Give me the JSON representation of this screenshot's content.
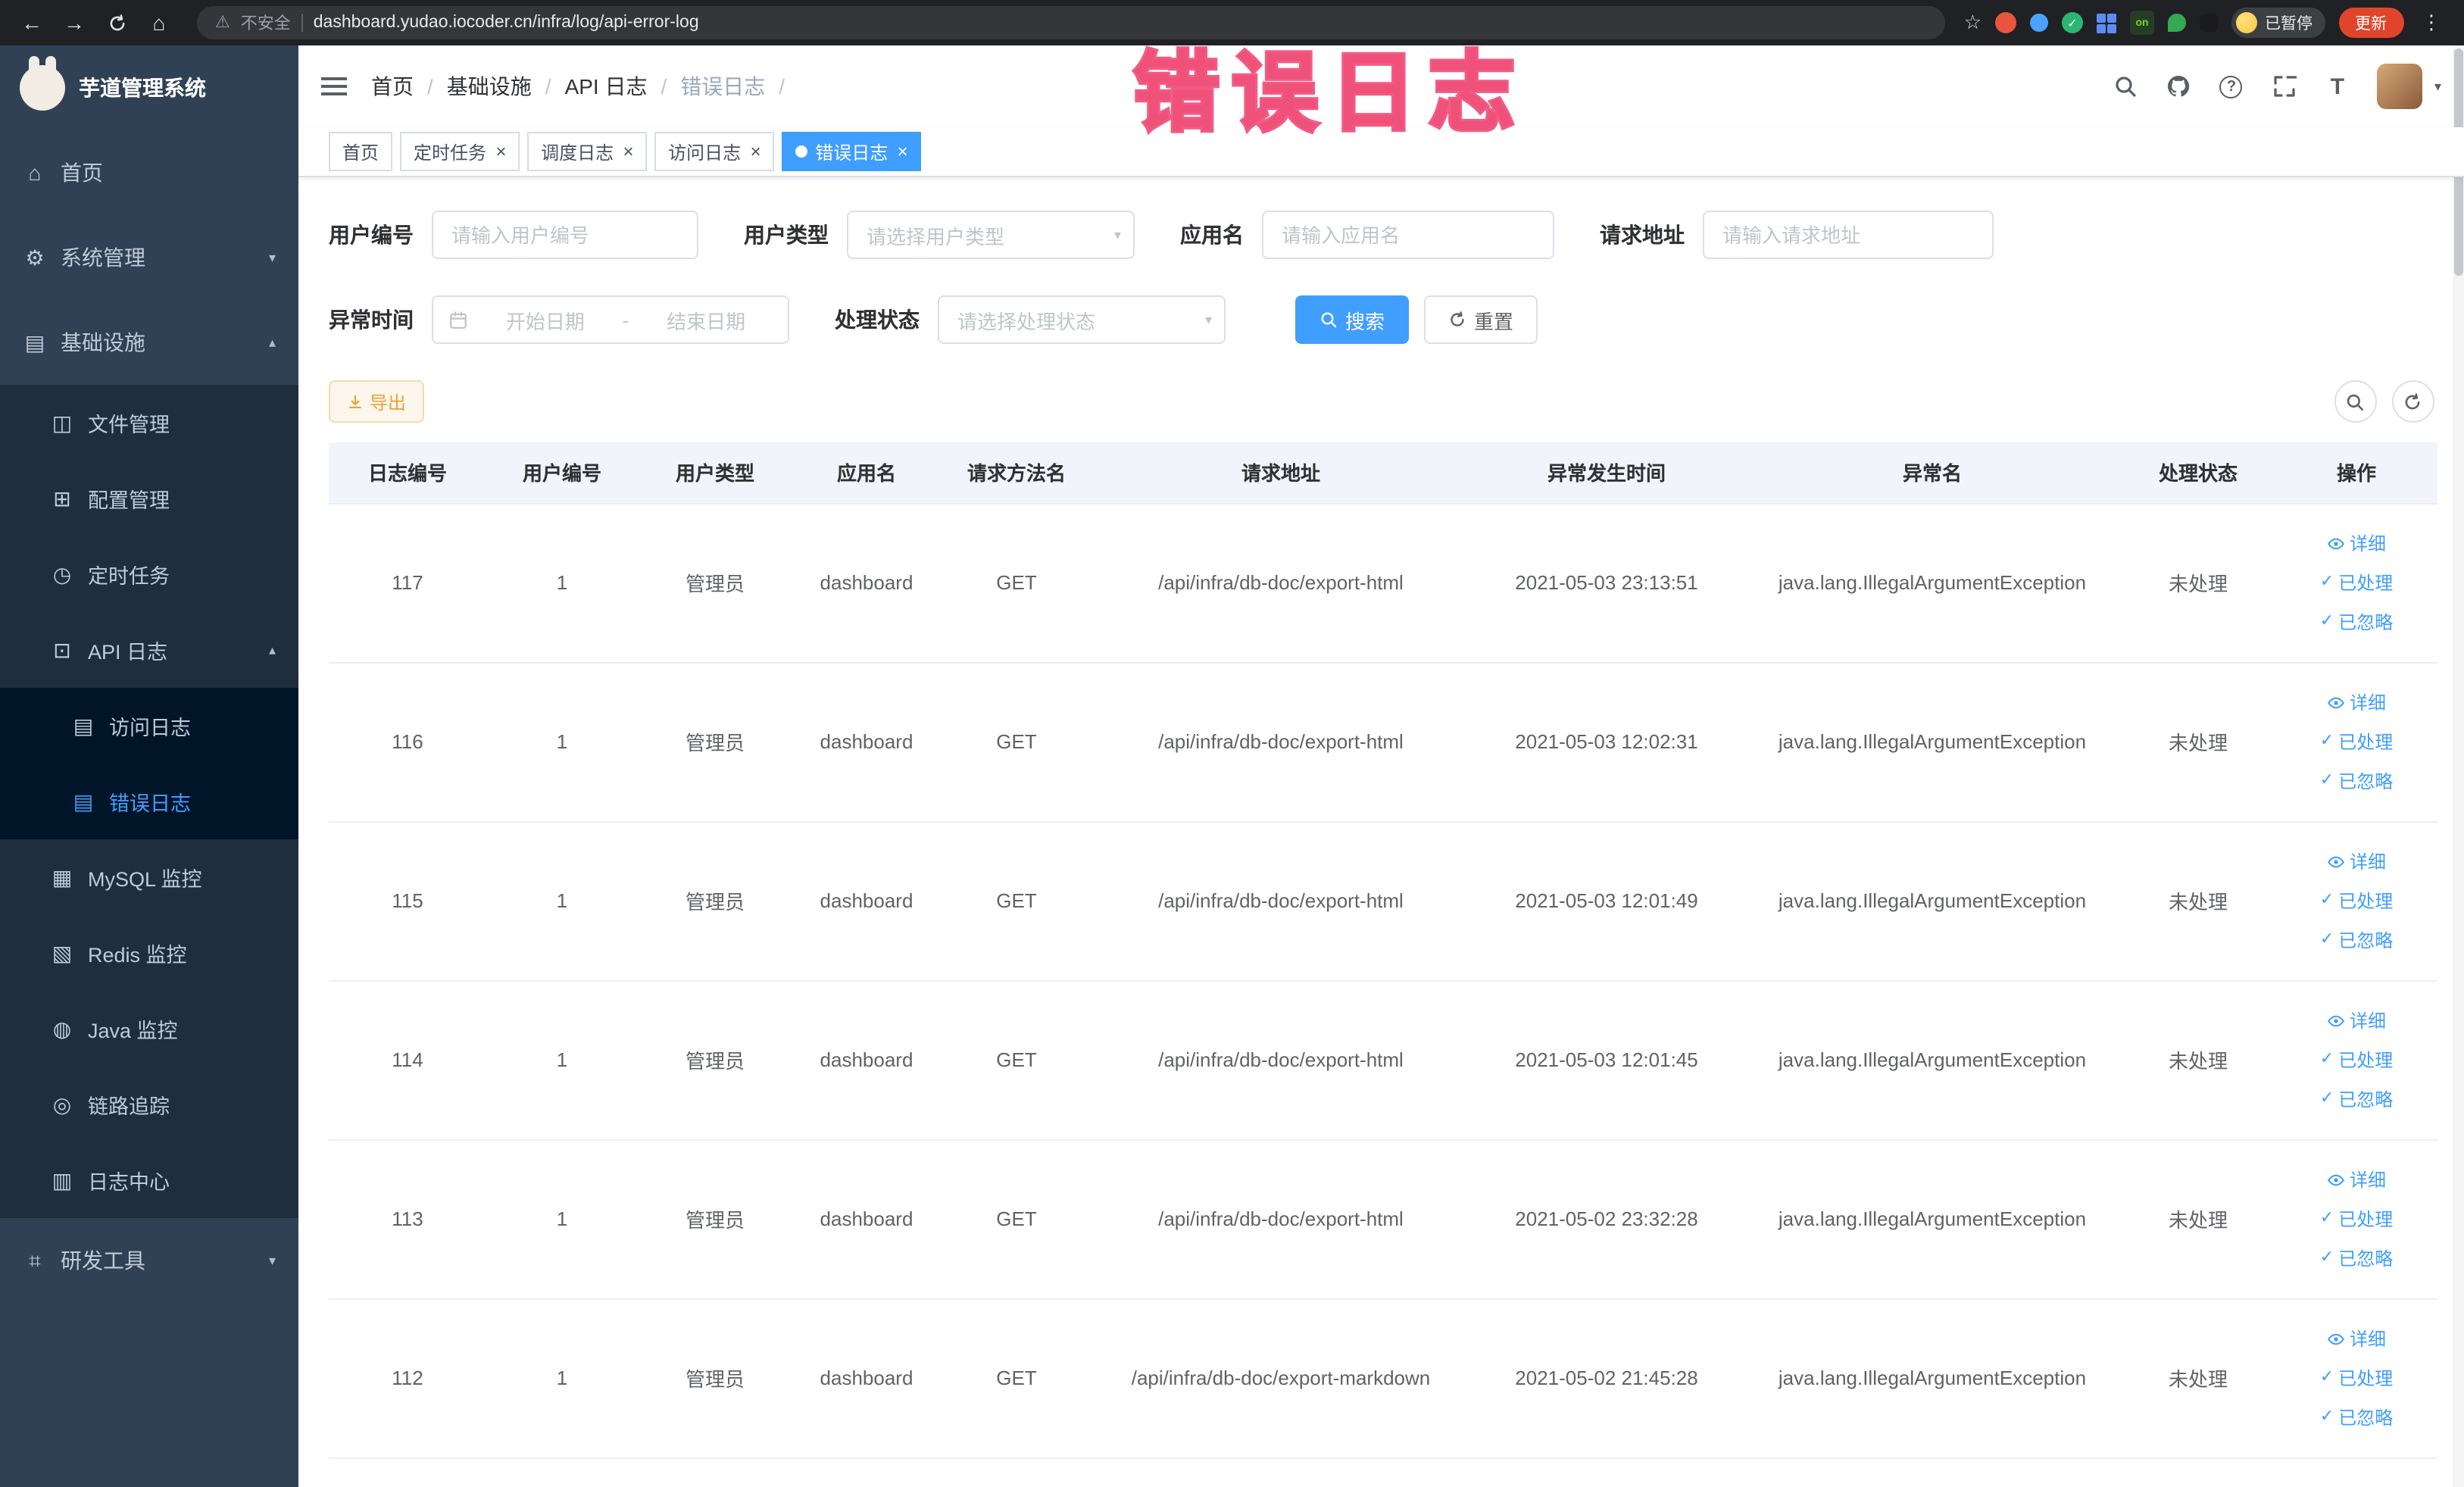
{
  "browser": {
    "security_label": "不安全",
    "url": "dashboard.yudao.iocoder.cn/infra/log/api-error-log",
    "extension_on_badge": "on",
    "paused_badge": "已暂停",
    "update_button": "更新"
  },
  "annotation": {
    "text": "错误日志"
  },
  "colors": {
    "accent": "#409eff",
    "sidebar_bg": "#304156",
    "submenu_bg": "#1f2d3d",
    "submenu_deep_bg": "#001528",
    "active_tab_bg": "#409eff",
    "annotation_pink": "#ee3f6f",
    "warning_button_text": "#e6a23c",
    "update_button_bg": "#e0452c"
  },
  "sidebar": {
    "logo_title": "芋道管理系统",
    "items": [
      {
        "label": "首页",
        "icon": "home-icon",
        "css": "level-0"
      },
      {
        "label": "系统管理",
        "icon": "gear-icon",
        "css": "level-0",
        "chevron_down": true
      },
      {
        "label": "基础设施",
        "icon": "infrastructure-icon",
        "css": "level-0",
        "chevron_up": true
      },
      {
        "label": "文件管理",
        "icon": "file-icon",
        "css": "level-1"
      },
      {
        "label": "配置管理",
        "icon": "config-icon",
        "css": "level-1"
      },
      {
        "label": "定时任务",
        "icon": "timer-icon",
        "css": "level-1"
      },
      {
        "label": "API 日志",
        "icon": "api-log-icon",
        "css": "level-1",
        "chevron_up": true
      },
      {
        "label": "访问日志",
        "icon": "access-log-icon",
        "css": "level-2"
      },
      {
        "label": "错误日志",
        "icon": "error-log-icon",
        "css": "level-2",
        "active": true
      },
      {
        "label": "MySQL 监控",
        "icon": "mysql-icon",
        "css": "level-1"
      },
      {
        "label": "Redis 监控",
        "icon": "redis-icon",
        "css": "level-1"
      },
      {
        "label": "Java 监控",
        "icon": "java-icon",
        "css": "level-1"
      },
      {
        "label": "链路追踪",
        "icon": "trace-icon",
        "css": "level-1"
      },
      {
        "label": "日志中心",
        "icon": "log-center-icon",
        "css": "level-1"
      },
      {
        "label": "研发工具",
        "icon": "dev-tools-icon",
        "css": "level-0",
        "chevron_down": true
      }
    ]
  },
  "header": {
    "breadcrumb": [
      {
        "label": "首页"
      },
      {
        "label": "基础设施"
      },
      {
        "label": "API 日志"
      },
      {
        "label": "错误日志",
        "current": true
      }
    ]
  },
  "tabs": [
    {
      "label": "首页"
    },
    {
      "label": "定时任务",
      "closable": true
    },
    {
      "label": "调度日志",
      "closable": true
    },
    {
      "label": "访问日志",
      "closable": true
    },
    {
      "label": "错误日志",
      "closable": true,
      "active": true
    }
  ],
  "filters": {
    "user_id": {
      "label": "用户编号",
      "placeholder": "请输入用户编号"
    },
    "user_type": {
      "label": "用户类型",
      "placeholder": "请选择用户类型"
    },
    "app_name": {
      "label": "应用名",
      "placeholder": "请输入应用名"
    },
    "request_url": {
      "label": "请求地址",
      "placeholder": "请输入请求地址"
    },
    "exception_time": {
      "label": "异常时间",
      "start_placeholder": "开始日期",
      "separator": "-",
      "end_placeholder": "结束日期"
    },
    "process_status": {
      "label": "处理状态",
      "placeholder": "请选择处理状态"
    },
    "search_button": "搜索",
    "reset_button": "重置"
  },
  "toolbar": {
    "export_button": "导出"
  },
  "table": {
    "columns": [
      "日志编号",
      "用户编号",
      "用户类型",
      "应用名",
      "请求方法名",
      "请求地址",
      "异常发生时间",
      "异常名",
      "处理状态",
      "操作"
    ],
    "actions": [
      "详细",
      "已处理",
      "已忽略"
    ],
    "rows": [
      {
        "id": "117",
        "user_id": "1",
        "user_type": "管理员",
        "app": "dashboard",
        "method": "GET",
        "url": "/api/infra/db-doc/export-html",
        "time": "2021-05-03 23:13:51",
        "exception": "java.lang.IllegalArgumentException",
        "status": "未处理"
      },
      {
        "id": "116",
        "user_id": "1",
        "user_type": "管理员",
        "app": "dashboard",
        "method": "GET",
        "url": "/api/infra/db-doc/export-html",
        "time": "2021-05-03 12:02:31",
        "exception": "java.lang.IllegalArgumentException",
        "status": "未处理"
      },
      {
        "id": "115",
        "user_id": "1",
        "user_type": "管理员",
        "app": "dashboard",
        "method": "GET",
        "url": "/api/infra/db-doc/export-html",
        "time": "2021-05-03 12:01:49",
        "exception": "java.lang.IllegalArgumentException",
        "status": "未处理"
      },
      {
        "id": "114",
        "user_id": "1",
        "user_type": "管理员",
        "app": "dashboard",
        "method": "GET",
        "url": "/api/infra/db-doc/export-html",
        "time": "2021-05-03 12:01:45",
        "exception": "java.lang.IllegalArgumentException",
        "status": "未处理"
      },
      {
        "id": "113",
        "user_id": "1",
        "user_type": "管理员",
        "app": "dashboard",
        "method": "GET",
        "url": "/api/infra/db-doc/export-html",
        "time": "2021-05-02 23:32:28",
        "exception": "java.lang.IllegalArgumentException",
        "status": "未处理"
      },
      {
        "id": "112",
        "user_id": "1",
        "user_type": "管理员",
        "app": "dashboard",
        "method": "GET",
        "url": "/api/infra/db-doc/export-markdown",
        "time": "2021-05-02 21:45:28",
        "exception": "java.lang.IllegalArgumentException",
        "status": "未处理"
      }
    ]
  }
}
